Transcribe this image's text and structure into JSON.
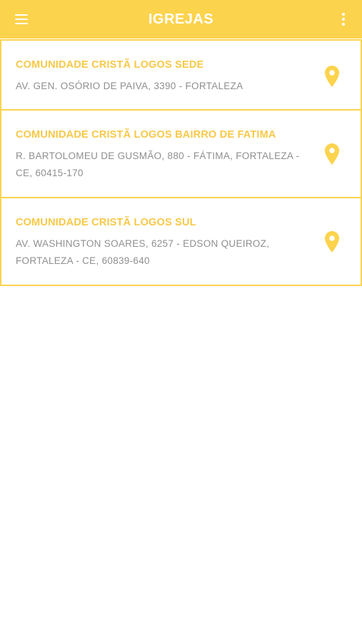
{
  "header": {
    "title": "IGREJAS",
    "menu_icon": "hamburger-menu-icon",
    "more_icon": "more-vertical-icon"
  },
  "colors": {
    "accent": "#fcd34d",
    "title_text": "#f7c948",
    "address_text": "#8f8f8f"
  },
  "churches": [
    {
      "name": "COMUNIDADE CRISTÃ LOGOS SEDE",
      "address": "AV. GEN. OSÓRIO DE PAIVA, 3390 - FORTALEZA",
      "icon": "location-pin-icon"
    },
    {
      "name": "COMUNIDADE CRISTÃ LOGOS BAIRRO DE FATIMA",
      "address": "R. BARTOLOMEU DE GUSMÃO, 880 - FÁTIMA, FORTALEZA - CE, 60415-170",
      "icon": "location-pin-icon"
    },
    {
      "name": "COMUNIDADE CRISTÃ LOGOS SUL",
      "address": "AV. WASHINGTON SOARES, 6257 - EDSON QUEIROZ, FORTALEZA - CE, 60839-640",
      "icon": "location-pin-icon"
    }
  ]
}
